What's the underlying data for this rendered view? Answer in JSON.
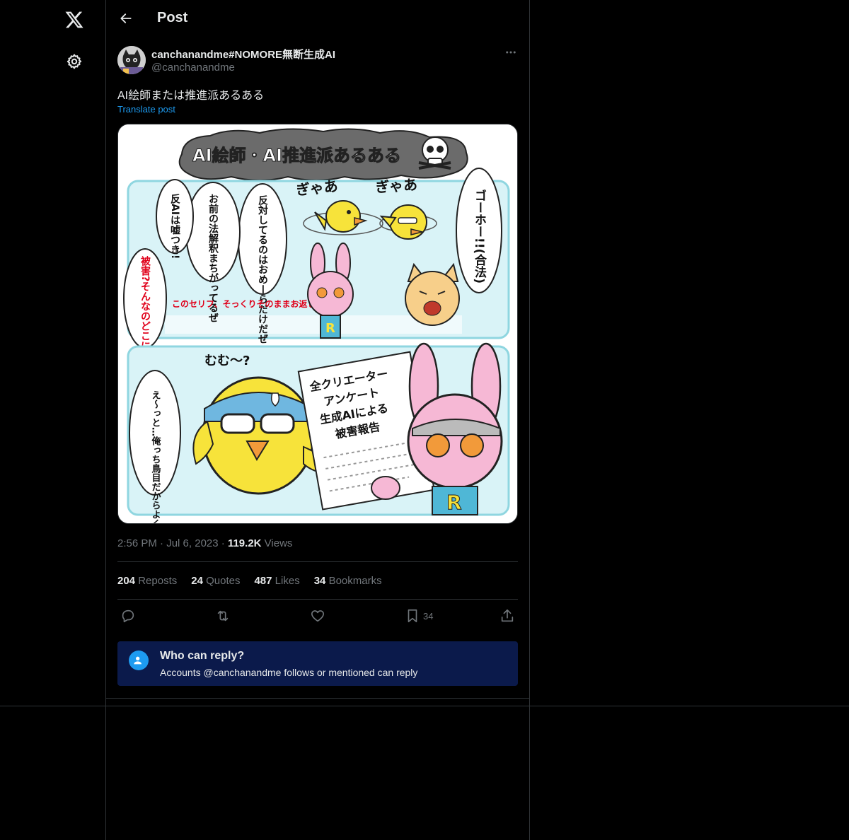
{
  "nav": {
    "logo_icon": "x-logo-icon",
    "settings_icon": "gear-icon"
  },
  "header": {
    "back_icon": "arrow-left-icon",
    "title": "Post"
  },
  "post": {
    "author": {
      "display_name": "canchanandme#NOMORE無断生成AI",
      "handle": "@canchanandme"
    },
    "text": "AI絵師または推進派あるある",
    "translate_label": "Translate post",
    "media": {
      "title": "AI絵師・AI推進派あるある",
      "panel1": {
        "sfx_left": "ぎゃあ",
        "sfx_right": "ぎゃあ",
        "bubble_goho": "ゴーホー!!(合法)",
        "bubble_hantai": "反対してるのはおめーらだけだぜ",
        "bubble_hokaishaku": "お前の法解釈まちがってるぜ",
        "bubble_uso": "反AIは嘘つき!",
        "bubble_higai": "被害?そんなのどこにある?",
        "caption": "このセリフ、そっくりそのままお返しします"
      },
      "panel2": {
        "sfx": "むむ〜?",
        "doc_line1": "全クリエーター",
        "doc_line2": "アンケート",
        "doc_line3": "生成AIによる",
        "doc_line4": "被害報告",
        "bubble_tori": "え〜っと…俺っち鳥目だからよく見えないや〜",
        "shirt_letter": "R"
      }
    },
    "time": "2:56 PM",
    "date": "Jul 6, 2023",
    "views_count": "119.2K",
    "views_label": "Views",
    "stats": {
      "reposts_count": "204",
      "reposts_label": "Reposts",
      "quotes_count": "24",
      "quotes_label": "Quotes",
      "likes_count": "487",
      "likes_label": "Likes",
      "bookmarks_count": "34",
      "bookmarks_label": "Bookmarks"
    },
    "actions": {
      "reply_icon": "comment-icon",
      "repost_icon": "repost-icon",
      "like_icon": "heart-icon",
      "bookmark_icon": "bookmark-icon",
      "bookmark_count": "34",
      "share_icon": "share-icon"
    },
    "reply_restriction": {
      "title": "Who can reply?",
      "subtitle": "Accounts @canchanandme follows or mentioned can reply"
    }
  },
  "colors": {
    "background": "#000000",
    "text": "#e7e9ea",
    "muted": "#71767b",
    "accent": "#1d9bf0",
    "border": "#2f3336",
    "reply_box": "#0b1a4b"
  }
}
